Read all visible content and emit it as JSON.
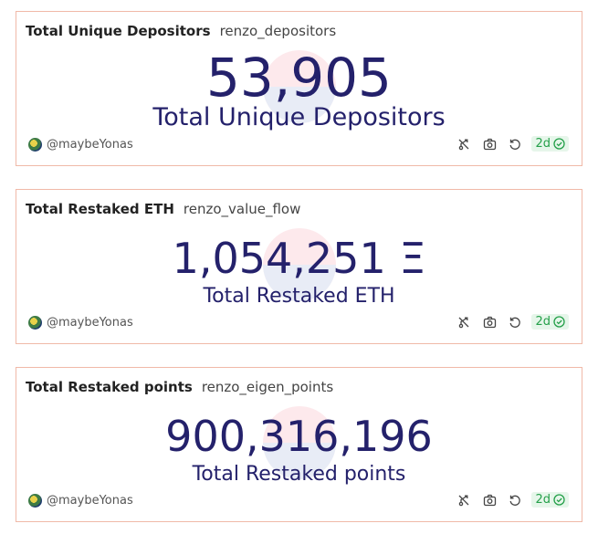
{
  "cards": [
    {
      "title": "Total Unique Depositors",
      "query": "renzo_depositors",
      "value": "53,905",
      "label": "Total Unique Depositors",
      "author": "@maybeYonas",
      "age": "2d"
    },
    {
      "title": "Total Restaked ETH",
      "query": "renzo_value_flow",
      "value": "1,054,251 Ξ",
      "label": "Total Restaked ETH",
      "author": "@maybeYonas",
      "age": "2d"
    },
    {
      "title": "Total Restaked points",
      "query": "renzo_eigen_points",
      "value": "900,316,196",
      "label": "Total Restaked points",
      "author": "@maybeYonas",
      "age": "2d"
    }
  ],
  "colors": {
    "value_text": "#24216b",
    "card_border": "#f0b9a8",
    "badge_text": "#25a04a",
    "badge_bg": "#e6f6ea"
  },
  "icons": [
    "fork-icon",
    "camera-icon",
    "refresh-icon",
    "check-circle-icon"
  ]
}
